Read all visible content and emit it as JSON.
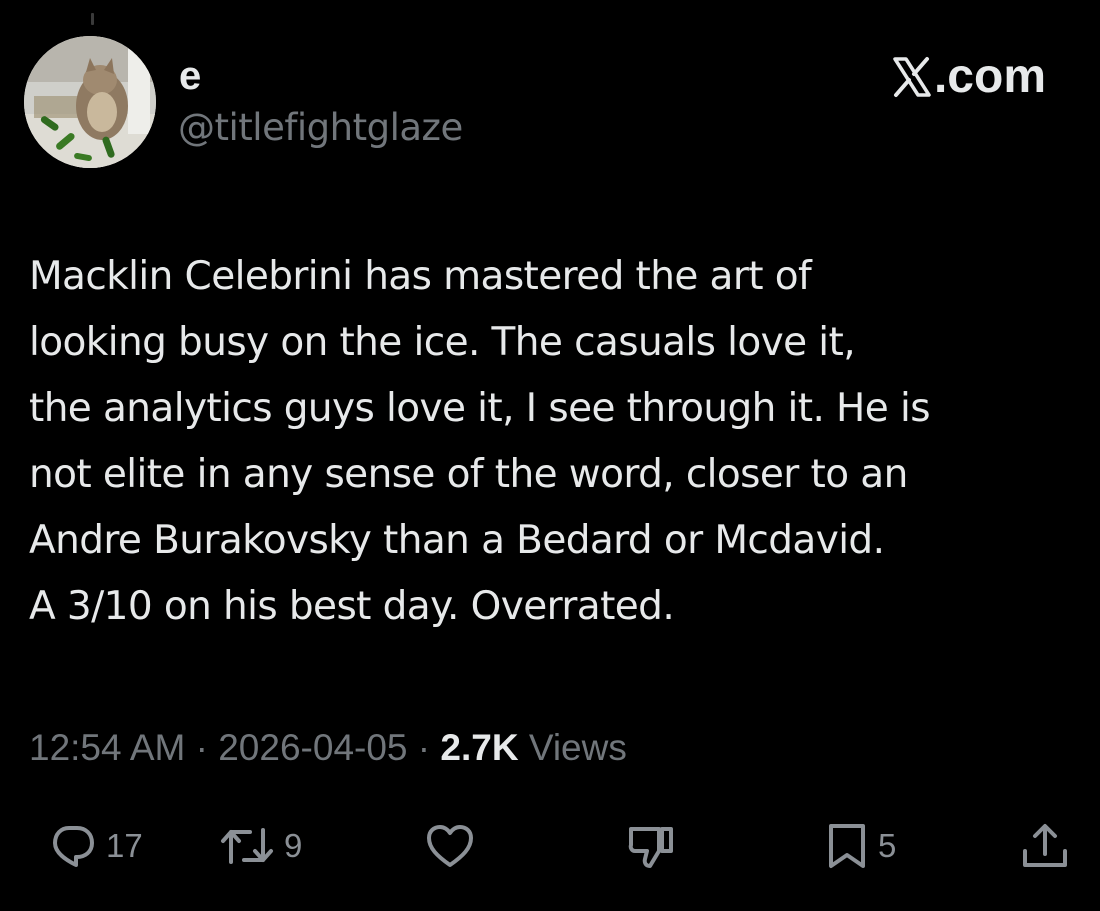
{
  "author": {
    "display_name": "e",
    "handle": "@titlefightglaze",
    "avatar_icon": "cat-with-cucumbers-avatar"
  },
  "brand": {
    "label": ".com",
    "icon": "x-logo-icon"
  },
  "post": {
    "lines": [
      "Macklin Celebrini has mastered the art of",
      "looking busy on the ice. The casuals love it,",
      "the analytics guys love it, I see through it. He is",
      "not elite in any sense of the word, closer to an",
      "Andre Burakovsky than a Bedard or Mcdavid.",
      "A 3/10 on his best day. Overrated."
    ]
  },
  "meta": {
    "time": "12:54 AM",
    "separator": "·",
    "date": "2026-04-05",
    "views_count": "2.7K",
    "views_label": "Views"
  },
  "actions": {
    "replies": {
      "icon": "reply-icon",
      "count": "17"
    },
    "reposts": {
      "icon": "repost-icon",
      "count": "9"
    },
    "like": {
      "icon": "heart-icon"
    },
    "dislike": {
      "icon": "thumbs-down-icon"
    },
    "bookmarks": {
      "icon": "bookmark-icon",
      "count": "5"
    },
    "share": {
      "icon": "share-icon"
    }
  },
  "colors": {
    "background": "#000000",
    "primary_text": "#e7e9ea",
    "secondary_text": "#71767b"
  }
}
